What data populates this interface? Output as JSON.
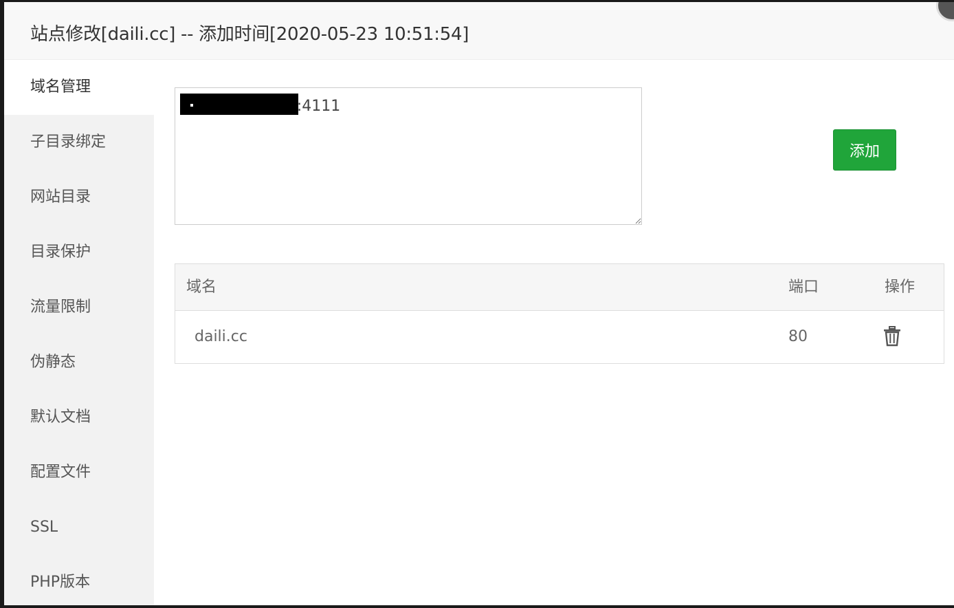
{
  "dialog": {
    "title": "站点修改[daili.cc] -- 添加时间[2020-05-23 10:51:54]"
  },
  "sidebar": {
    "items": [
      {
        "label": "域名管理",
        "active": true
      },
      {
        "label": "子目录绑定"
      },
      {
        "label": "网站目录"
      },
      {
        "label": "目录保护"
      },
      {
        "label": "流量限制"
      },
      {
        "label": "伪静态"
      },
      {
        "label": "默认文档"
      },
      {
        "label": "配置文件"
      },
      {
        "label": "SSL"
      },
      {
        "label": "PHP版本"
      }
    ]
  },
  "domain_input": {
    "value": "                       :4111"
  },
  "add_button": {
    "label": "添加"
  },
  "table": {
    "columns": [
      "域名",
      "端口",
      "操作"
    ],
    "rows": [
      {
        "domain": "daili.cc",
        "port": "80",
        "action_icon": "trash-icon"
      }
    ]
  },
  "colors": {
    "accent": "#20a53a",
    "sidebar_bg": "#f2f2f2",
    "title_bg": "#f8f8f8"
  }
}
